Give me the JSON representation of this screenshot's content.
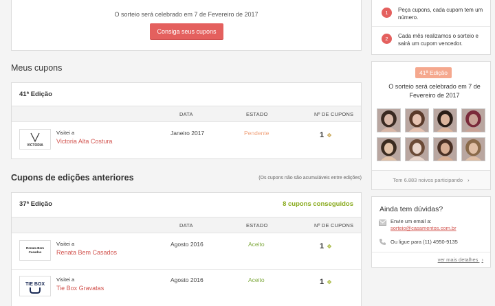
{
  "top": {
    "notice": "O sorteio será celebrado em 7 de Fevereiro de 2017",
    "button_label": "Consiga seus cupons"
  },
  "my_coupons": {
    "title": "Meus cupons",
    "edition": "41ª Edição",
    "headers": {
      "date": "DATA",
      "status": "ESTADO",
      "count": "Nº DE CUPONS"
    },
    "rows": [
      {
        "visit_label": "Visitei a",
        "vendor": "Victoria Alta Costura",
        "logo": "VICTORIA",
        "date": "Janeiro 2017",
        "status": "Pendente",
        "count": "1"
      }
    ]
  },
  "previous": {
    "title": "Cupons de edições anteriores",
    "note": "(Os cupons não são acumuláveis entre edições)",
    "edition": "37ª Edição",
    "achieved": "8 cupons conseguidos",
    "headers": {
      "date": "DATA",
      "status": "ESTADO",
      "count": "Nº DE CUPONS"
    },
    "rows": [
      {
        "visit_label": "Visitei a",
        "vendor": "Renata Bem Casados",
        "logo": "Renata Bem Casados",
        "date": "Agosto 2016",
        "status": "Aceito",
        "count": "1"
      },
      {
        "visit_label": "Visitei a",
        "vendor": "Tie Box Gravatas",
        "logo": "TIE BOX",
        "date": "Agosto 2016",
        "status": "Aceito",
        "count": "1"
      }
    ]
  },
  "sidebar": {
    "steps": [
      {
        "num": "1",
        "text": "Peça cupons, cada cupom tem um número."
      },
      {
        "num": "2",
        "text": "Cada mês realizamos o sorteio e sairá um cupom vencedor."
      }
    ],
    "edition_badge": "41ª Edição",
    "notice": "O sorteio será celebrado em 7 de Fevereiro de 2017",
    "participants": "Tem 6.883 noivos participando",
    "help": {
      "title": "Ainda tem dúvidas?",
      "email_label": "Envie um email a:",
      "email": "sorteio@casamentos.com.br",
      "phone_label": "Ou ligue para",
      "phone": "(11) 4950-9135",
      "more": "ver mais detalhes"
    }
  },
  "colors": {
    "accent": "#e4605e",
    "pending": "#f0a37d",
    "accepted": "#7fa93e",
    "achieved": "#8aab1f"
  }
}
